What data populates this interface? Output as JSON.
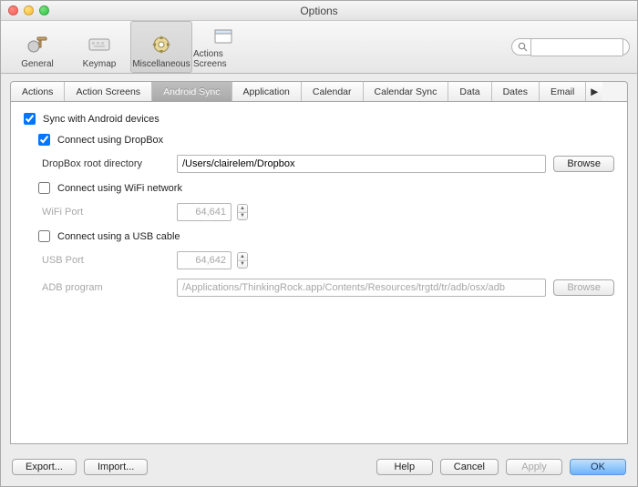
{
  "window": {
    "title": "Options"
  },
  "toolbar": {
    "items": [
      {
        "label": "General"
      },
      {
        "label": "Keymap"
      },
      {
        "label": "Miscellaneous"
      },
      {
        "label": "Actions Screens"
      }
    ],
    "search_placeholder": ""
  },
  "tabs": [
    "Actions",
    "Action Screens",
    "Android Sync",
    "Application",
    "Calendar",
    "Calendar Sync",
    "Data",
    "Dates",
    "Email"
  ],
  "sync": {
    "sync_label": "Sync with Android devices",
    "dropbox": {
      "label": "Connect using DropBox",
      "root_label": "DropBox root directory",
      "root_value": "/Users/clairelem/Dropbox",
      "browse": "Browse"
    },
    "wifi": {
      "label": "Connect using WiFi network",
      "port_label": "WiFi Port",
      "port_value": "64,641"
    },
    "usb": {
      "label": "Connect using a USB cable",
      "port_label": "USB Port",
      "port_value": "64,642",
      "adb_label": "ADB program",
      "adb_value": "/Applications/ThinkingRock.app/Contents/Resources/trgtd/tr/adb/osx/adb",
      "browse": "Browse"
    }
  },
  "footer": {
    "export": "Export...",
    "import": "Import...",
    "help": "Help",
    "cancel": "Cancel",
    "apply": "Apply",
    "ok": "OK"
  }
}
